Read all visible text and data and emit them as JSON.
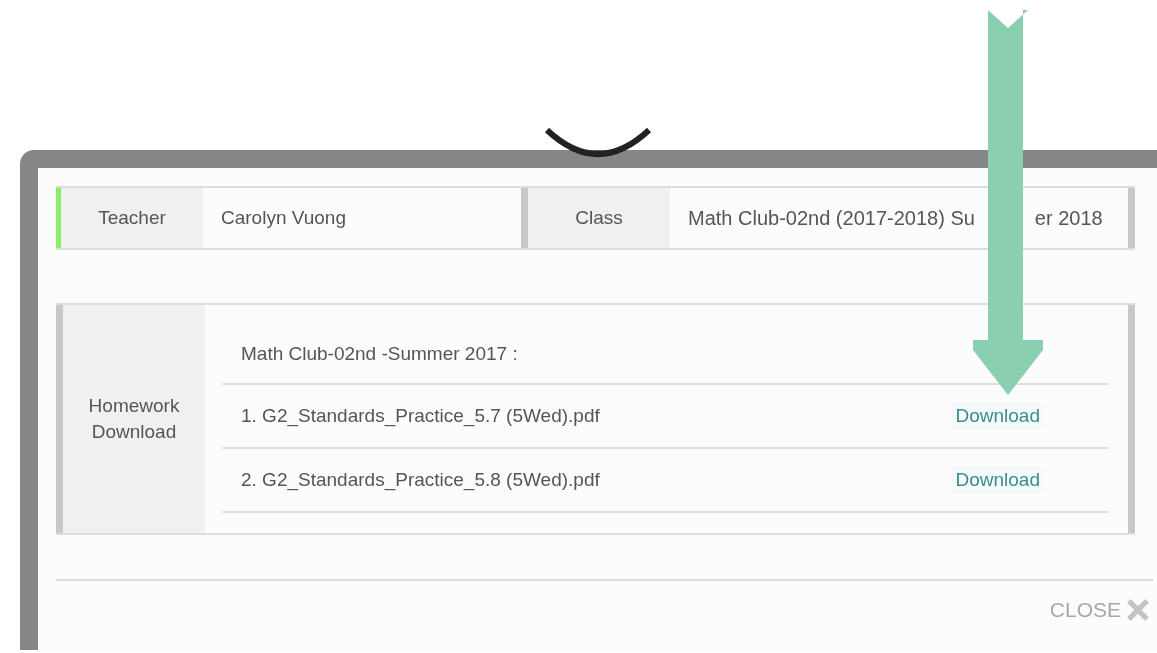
{
  "info": [
    {
      "label": "Teacher",
      "value": "Carolyn Vuong"
    },
    {
      "label": "Class",
      "value": "Math Club-02nd (2017-2018) Su",
      "value_after_arrow": "er 2018"
    }
  ],
  "homework": {
    "label": "Homework Download",
    "heading": "Math Club-02nd -Summer 2017 :",
    "files": [
      {
        "name": "1. G2_Standards_Practice_5.7 (5Wed).pdf",
        "action": "Download"
      },
      {
        "name": "2. G2_Standards_Practice_5.8 (5Wed).pdf",
        "action": "Download"
      }
    ]
  },
  "close": {
    "label": "CLOSE"
  }
}
